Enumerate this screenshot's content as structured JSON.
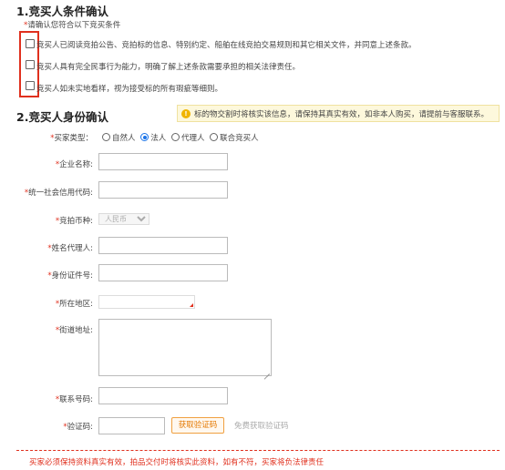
{
  "section1": {
    "title": "1.竞买人条件确认",
    "prompt": "请确认您符合以下竞买条件",
    "conditions": [
      "竞买人已阅读竞拍公告、竞拍标的信息、特别约定、船舶在线竞拍交易规则和其它相关文件，并同意上述条款。",
      "竞买人具有完全民事行为能力，明确了解上述条款需要承担的相关法律责任。",
      "竞买人如未实地看样，视为接受标的所有瑕疵等细则。"
    ]
  },
  "section2": {
    "title": "2.竞买人身份确认",
    "tip": "标的物交割时将核实该信息，请保持其真实有效，如非本人购买，请提前与客服联系。"
  },
  "form": {
    "buyer_type_label": "买家类型：",
    "buyer_type_options": [
      "自然人",
      "法人",
      "代理人",
      "联合竞买人"
    ],
    "buyer_type_selected": "法人",
    "company_name_label": "企业名称:",
    "credit_code_label": "统一社会信用代码:",
    "currency_label": "竞拍币种:",
    "currency_value": "人民币",
    "agent_name_label": "姓名代理人:",
    "id_number_label": "身份证件号:",
    "region_label": "所在地区:",
    "street_label": "街道地址:",
    "phone_label": "联系号码:",
    "captcha_label": "验证码:",
    "get_code_button": "获取验证码",
    "free_code_link": "免费获取验证码"
  },
  "footer": "买家必须保持资料真实有效，拍品交付时将核实此资料，如有不符，买家将负法律责任",
  "colors": {
    "required": "#e0301e",
    "accent_orange": "#e47800",
    "radio_selected": "#1a73e8",
    "tip_bg": "#fdf8dc"
  }
}
